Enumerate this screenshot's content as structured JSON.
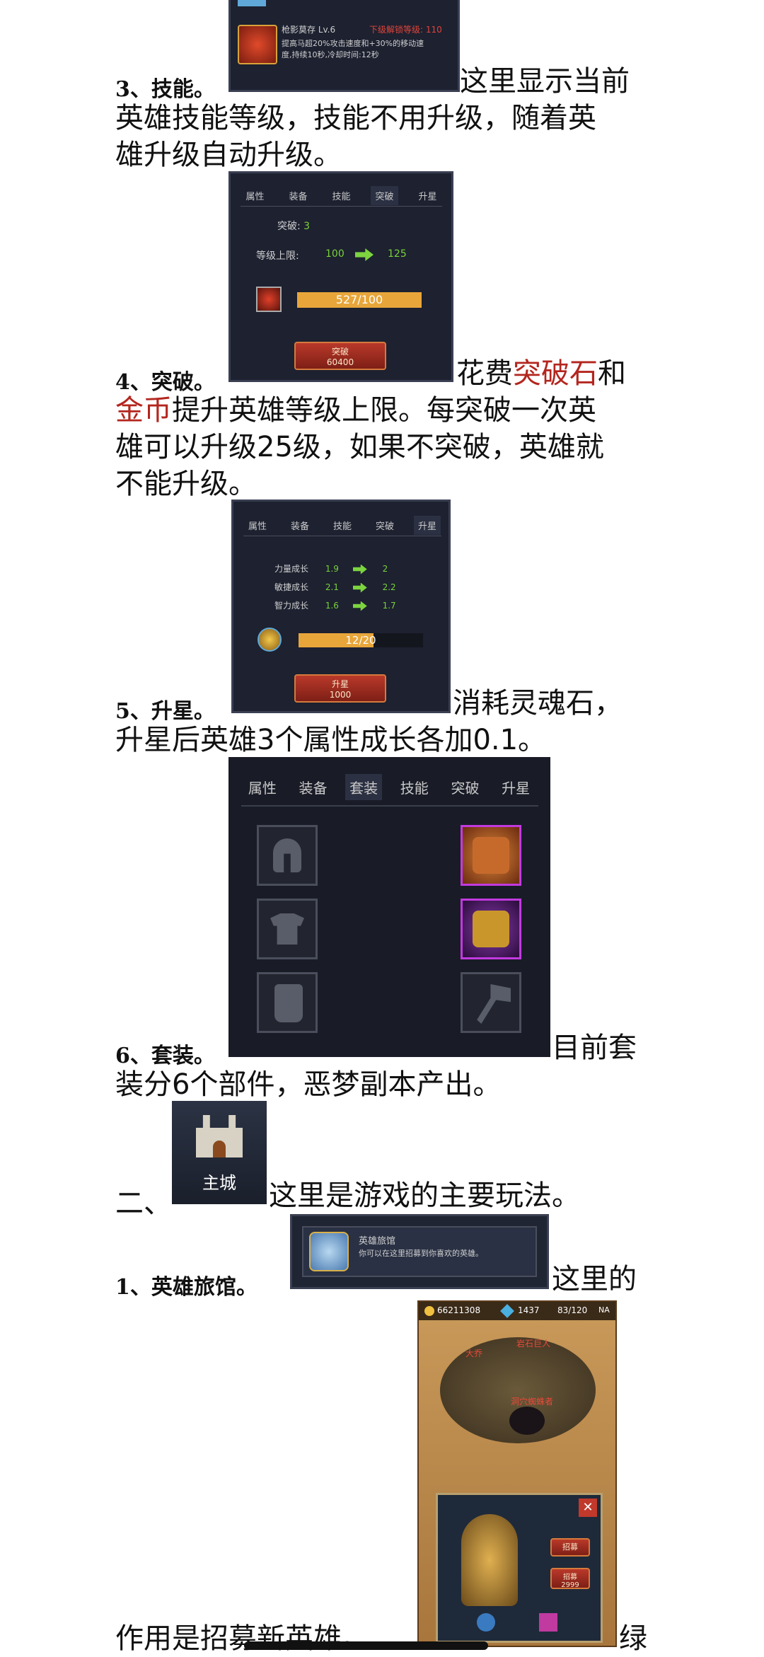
{
  "skill_card": {
    "title": "枪影莫存 Lv.6",
    "red_note": "下级解锁等级: 110",
    "desc1": "提高马超20%攻击速度和+30%的移动速",
    "desc2": "度,持续10秒,冷却时间:12秒"
  },
  "sections": {
    "s3": {
      "heading": "3、技能。",
      "line1": "这里显示当前",
      "line2": "英雄技能等级，技能不用升级，随着英",
      "line3": "雄升级自动升级。"
    },
    "s4": {
      "heading": "4、突破。",
      "seg1": "花费",
      "seg2": "突破石",
      "seg3": "和",
      "seg4": "金币",
      "seg5": "提升英雄等级上限。每突破一次英",
      "line3": "雄可以升级25级，如果不突破，英雄就",
      "line4": "不能升级。"
    },
    "s5": {
      "heading": "5、升星。",
      "line1": "消耗灵魂石，",
      "line2": "升星后英雄3个属性成长各加0.1。"
    },
    "s6": {
      "heading": "6、套装。",
      "line1": "目前套",
      "line2": "装分6个部件，恶梦副本产出。"
    },
    "s_main": {
      "heading": "二、",
      "line1": "这里是游戏的主要玩法。"
    },
    "s_inn": {
      "heading": "1、英雄旅馆。",
      "line1": "这里的",
      "line2": "作用是招募新英雄。",
      "line2_end": "绿"
    }
  },
  "breakthrough_panel": {
    "tabs": [
      "属性",
      "装备",
      "技能",
      "突破",
      "升星"
    ],
    "break_label": "突破: ",
    "break_value": "3",
    "level_label": "等级上限:",
    "level_from": "100",
    "level_to": "125",
    "progress": "527/100",
    "button_label": "突破",
    "button_cost": "60400"
  },
  "star_panel": {
    "tabs": [
      "属性",
      "装备",
      "技能",
      "突破",
      "升星"
    ],
    "rows": [
      {
        "label": "力量成长",
        "from": "1.9",
        "to": "2"
      },
      {
        "label": "敏捷成长",
        "from": "2.1",
        "to": "2.2"
      },
      {
        "label": "智力成长",
        "from": "1.6",
        "to": "1.7"
      }
    ],
    "progress": "12/20",
    "progress_fraction": 0.6,
    "button_label": "升星",
    "button_cost": "1000"
  },
  "set_panel": {
    "tabs": [
      "属性",
      "装备",
      "套装",
      "技能",
      "突破",
      "升星"
    ],
    "left_slots": [
      "helmet-icon",
      "armor-icon",
      "glove-icon"
    ],
    "right_slots": [
      "pants-item",
      "boots-item",
      "axe-icon"
    ]
  },
  "main_city": {
    "label": "主城"
  },
  "inn_card": {
    "title": "英雄旅馆",
    "desc": "你可以在这里招募到你喜欢的英雄。"
  },
  "game_screen": {
    "gold": "66211308",
    "gems": "1437",
    "stamina": "83/120",
    "extra": "NA",
    "names": [
      "大乔",
      "岩石巨人",
      "洞穴蜘蛛者"
    ],
    "btn1": "招募",
    "btn2": "招募",
    "btn2_cost": "2999"
  }
}
